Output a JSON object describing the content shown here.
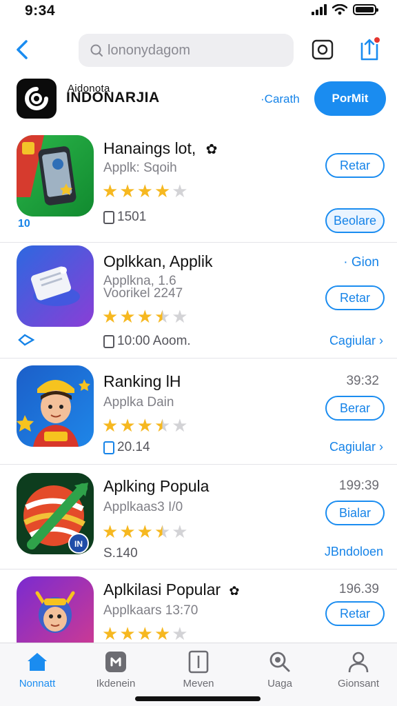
{
  "status": {
    "time": "9:34"
  },
  "search": {
    "placeholder": "lononydagom"
  },
  "publisher": {
    "small": "Aidonota",
    "name": "INDONARJIA",
    "link": "·Carath",
    "follow_label": "PorMit"
  },
  "apps": [
    {
      "title": "Hanaings lot,",
      "subtitle": "Applk: Sqoih",
      "subtitle2": "",
      "rating": 4,
      "meta": "1501",
      "badge": "10",
      "right_text": "",
      "pill": "Retar",
      "side": "Beolare",
      "side_style": "pill"
    },
    {
      "title": "Oplkkan, Applik",
      "subtitle": "Applkna,  1.6",
      "subtitle2": "Voorikel 2247",
      "rating": 3.5,
      "meta": "10:00 Aoom.",
      "badge": "",
      "right_text": "· Gion",
      "pill": "Retar",
      "side": "Cagiular",
      "side_style": "link"
    },
    {
      "title": "Ranking  lH",
      "subtitle": "Applka Dain",
      "subtitle2": "",
      "rating": 3.5,
      "meta": "20.14",
      "badge": "",
      "right_text": "39:32",
      "pill": "Berar",
      "side": "Cagiular",
      "side_style": "link"
    },
    {
      "title": "Aplking Popula",
      "subtitle": "Applkaas3 I/0",
      "subtitle2": "",
      "rating": 3.5,
      "meta": "S.140",
      "badge": "",
      "right_text": "199:39",
      "pill": "Bialar",
      "side": "JBndoloen",
      "side_style": "link"
    },
    {
      "title": "Aplkilasi Popular",
      "subtitle": "Applkaars 13:70",
      "subtitle2": "",
      "rating": 4,
      "meta": "",
      "badge": "",
      "right_text": "196.39",
      "pill": "Retar",
      "side": "",
      "side_style": "none"
    }
  ],
  "tabs": [
    {
      "label": "Nonnatt",
      "icon": "home-icon",
      "active": true
    },
    {
      "label": "Ikdenein",
      "icon": "apps-icon",
      "active": false
    },
    {
      "label": "Meven",
      "icon": "book-icon",
      "active": false
    },
    {
      "label": "Uaga",
      "icon": "search-icon",
      "active": false
    },
    {
      "label": "Gionsant",
      "icon": "person-icon",
      "active": false
    }
  ],
  "colors": {
    "accent": "#1a8cf0",
    "star": "#f6b820"
  }
}
